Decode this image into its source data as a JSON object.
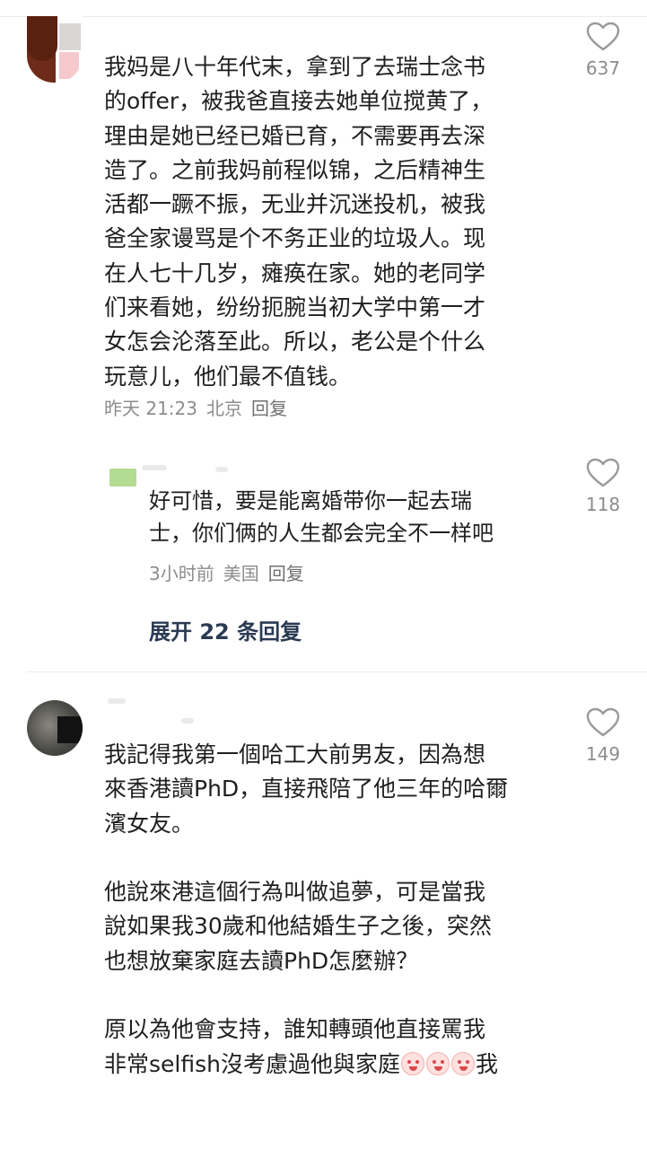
{
  "comments": [
    {
      "text_lines": [
        "我妈是八十年代末，拿到了去瑞士念书",
        "的offer，被我爸直接去她单位搅黄了，",
        "理由是她已经已婚已育，不需要再去深",
        "造了。之前我妈前程似锦，之后精神生",
        "活都一蹶不振，无业并沉迷投机，被我",
        "爸全家谩骂是个不务正业的垃圾人。现",
        "在人七十几岁，瘫痪在家。她的老同学",
        "们来看她，纷纷扼腕当初大学中第一才",
        "女怎会沦落至此。所以，老公是个什么",
        "玩意儿，他们最不值钱。"
      ],
      "time": "昨天 21:23",
      "location": "北京",
      "reply_label": "回复",
      "likes": "637"
    },
    {
      "text_lines": [
        "我記得我第一個哈工大前男友，因為想",
        "來香港讀PhD，直接飛陪了他三年的哈爾",
        "濱女友。",
        "",
        "他說來港這個行為叫做追夢，可是當我",
        "說如果我30歲和他結婚生子之後，突然",
        "也想放棄家庭去讀PhD怎麼辦？",
        "",
        "原以為他會支持，誰知轉頭他直接罵我",
        "非常selfish沒考慮過他與家庭"
      ],
      "trailing_text": "我",
      "emoji_name": "crying-emoji",
      "likes": "149"
    }
  ],
  "reply": {
    "text_lines": [
      "好可惜，要是能离婚带你一起去瑞",
      "士，你们俩的人生都会完全不一样吧"
    ],
    "time": "3小时前",
    "location": "美国",
    "reply_label": "回复",
    "likes": "118"
  },
  "expand_label": "展开 22 条回复",
  "colors": {
    "text": "#1f1f1f",
    "meta": "#8c8c8c",
    "expand": "#2a3a52",
    "icon": "#9a9a9a"
  }
}
